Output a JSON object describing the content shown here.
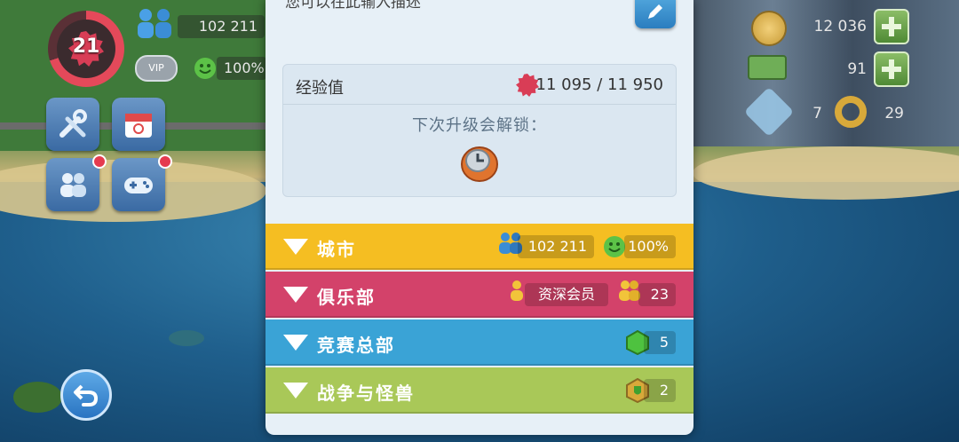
{
  "hud": {
    "level": "21",
    "population": "102 211",
    "happiness": "100%",
    "vip_label": "VIP",
    "simoleons": "12 036",
    "simcash": "91",
    "keys_blue": "7",
    "keys_gold": "29"
  },
  "panel": {
    "top_text_partial": "您可以在此输入描述",
    "xp_label": "经验值",
    "xp_value": "11 095 / 11 950",
    "unlock_label": "下次升级会解锁："
  },
  "sections": {
    "city": {
      "title": "城市",
      "population": "102 211",
      "happiness": "100%",
      "color": "#f5be22"
    },
    "club": {
      "title": "俱乐部",
      "rank": "资深会员",
      "members": "23",
      "color": "#d3426a"
    },
    "contest": {
      "title": "竞赛总部",
      "count": "5",
      "color": "#3aa3d6"
    },
    "war": {
      "title": "战争与怪兽",
      "count": "2",
      "color": "#a9c858"
    }
  },
  "icons": [
    "people-icon",
    "smiley-icon",
    "tools-icon",
    "calendar-icon",
    "friends-icon",
    "gamepad-icon",
    "back-arrow-icon",
    "coin-icon",
    "cash-icon",
    "plus-icon",
    "blue-key-icon",
    "gold-key-icon",
    "pencil-icon",
    "xp-star-icon",
    "unlock-item-icon",
    "triangle-down-icon",
    "member-icon",
    "shield-icon"
  ]
}
